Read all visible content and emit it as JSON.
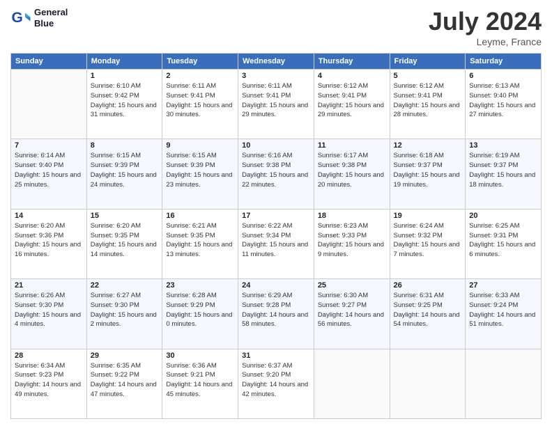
{
  "header": {
    "logo_line1": "General",
    "logo_line2": "Blue",
    "title": "July 2024",
    "location": "Leyme, France"
  },
  "weekdays": [
    "Sunday",
    "Monday",
    "Tuesday",
    "Wednesday",
    "Thursday",
    "Friday",
    "Saturday"
  ],
  "weeks": [
    [
      {
        "empty": true
      },
      {
        "day": "1",
        "sunrise": "6:10 AM",
        "sunset": "9:42 PM",
        "daylight": "15 hours and 31 minutes."
      },
      {
        "day": "2",
        "sunrise": "6:11 AM",
        "sunset": "9:41 PM",
        "daylight": "15 hours and 30 minutes."
      },
      {
        "day": "3",
        "sunrise": "6:11 AM",
        "sunset": "9:41 PM",
        "daylight": "15 hours and 29 minutes."
      },
      {
        "day": "4",
        "sunrise": "6:12 AM",
        "sunset": "9:41 PM",
        "daylight": "15 hours and 29 minutes."
      },
      {
        "day": "5",
        "sunrise": "6:12 AM",
        "sunset": "9:41 PM",
        "daylight": "15 hours and 28 minutes."
      },
      {
        "day": "6",
        "sunrise": "6:13 AM",
        "sunset": "9:40 PM",
        "daylight": "15 hours and 27 minutes."
      }
    ],
    [
      {
        "day": "7",
        "sunrise": "6:14 AM",
        "sunset": "9:40 PM",
        "daylight": "15 hours and 25 minutes."
      },
      {
        "day": "8",
        "sunrise": "6:15 AM",
        "sunset": "9:39 PM",
        "daylight": "15 hours and 24 minutes."
      },
      {
        "day": "9",
        "sunrise": "6:15 AM",
        "sunset": "9:39 PM",
        "daylight": "15 hours and 23 minutes."
      },
      {
        "day": "10",
        "sunrise": "6:16 AM",
        "sunset": "9:38 PM",
        "daylight": "15 hours and 22 minutes."
      },
      {
        "day": "11",
        "sunrise": "6:17 AM",
        "sunset": "9:38 PM",
        "daylight": "15 hours and 20 minutes."
      },
      {
        "day": "12",
        "sunrise": "6:18 AM",
        "sunset": "9:37 PM",
        "daylight": "15 hours and 19 minutes."
      },
      {
        "day": "13",
        "sunrise": "6:19 AM",
        "sunset": "9:37 PM",
        "daylight": "15 hours and 18 minutes."
      }
    ],
    [
      {
        "day": "14",
        "sunrise": "6:20 AM",
        "sunset": "9:36 PM",
        "daylight": "15 hours and 16 minutes."
      },
      {
        "day": "15",
        "sunrise": "6:20 AM",
        "sunset": "9:35 PM",
        "daylight": "15 hours and 14 minutes."
      },
      {
        "day": "16",
        "sunrise": "6:21 AM",
        "sunset": "9:35 PM",
        "daylight": "15 hours and 13 minutes."
      },
      {
        "day": "17",
        "sunrise": "6:22 AM",
        "sunset": "9:34 PM",
        "daylight": "15 hours and 11 minutes."
      },
      {
        "day": "18",
        "sunrise": "6:23 AM",
        "sunset": "9:33 PM",
        "daylight": "15 hours and 9 minutes."
      },
      {
        "day": "19",
        "sunrise": "6:24 AM",
        "sunset": "9:32 PM",
        "daylight": "15 hours and 7 minutes."
      },
      {
        "day": "20",
        "sunrise": "6:25 AM",
        "sunset": "9:31 PM",
        "daylight": "15 hours and 6 minutes."
      }
    ],
    [
      {
        "day": "21",
        "sunrise": "6:26 AM",
        "sunset": "9:30 PM",
        "daylight": "15 hours and 4 minutes."
      },
      {
        "day": "22",
        "sunrise": "6:27 AM",
        "sunset": "9:30 PM",
        "daylight": "15 hours and 2 minutes."
      },
      {
        "day": "23",
        "sunrise": "6:28 AM",
        "sunset": "9:29 PM",
        "daylight": "15 hours and 0 minutes."
      },
      {
        "day": "24",
        "sunrise": "6:29 AM",
        "sunset": "9:28 PM",
        "daylight": "14 hours and 58 minutes."
      },
      {
        "day": "25",
        "sunrise": "6:30 AM",
        "sunset": "9:27 PM",
        "daylight": "14 hours and 56 minutes."
      },
      {
        "day": "26",
        "sunrise": "6:31 AM",
        "sunset": "9:25 PM",
        "daylight": "14 hours and 54 minutes."
      },
      {
        "day": "27",
        "sunrise": "6:33 AM",
        "sunset": "9:24 PM",
        "daylight": "14 hours and 51 minutes."
      }
    ],
    [
      {
        "day": "28",
        "sunrise": "6:34 AM",
        "sunset": "9:23 PM",
        "daylight": "14 hours and 49 minutes."
      },
      {
        "day": "29",
        "sunrise": "6:35 AM",
        "sunset": "9:22 PM",
        "daylight": "14 hours and 47 minutes."
      },
      {
        "day": "30",
        "sunrise": "6:36 AM",
        "sunset": "9:21 PM",
        "daylight": "14 hours and 45 minutes."
      },
      {
        "day": "31",
        "sunrise": "6:37 AM",
        "sunset": "9:20 PM",
        "daylight": "14 hours and 42 minutes."
      },
      {
        "empty": true
      },
      {
        "empty": true
      },
      {
        "empty": true
      }
    ]
  ]
}
